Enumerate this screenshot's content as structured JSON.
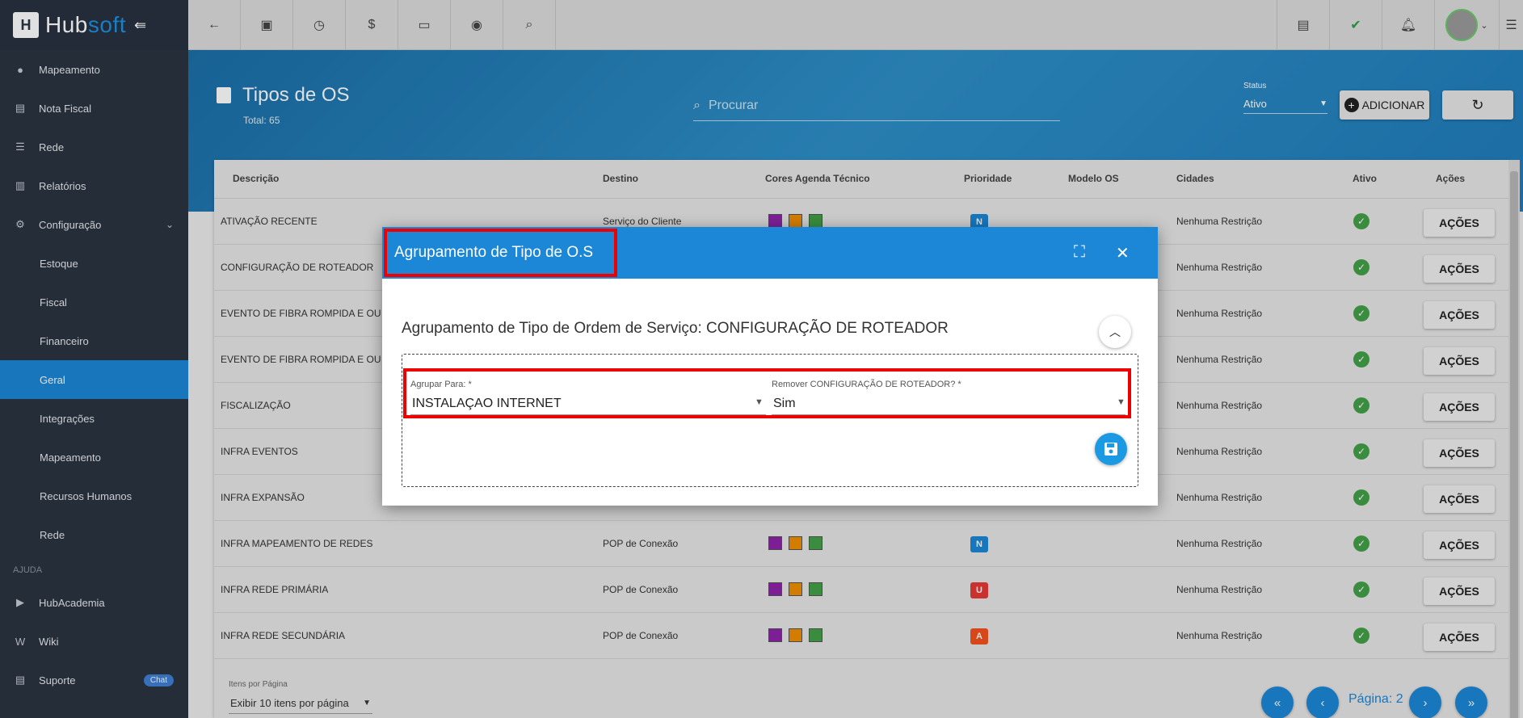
{
  "brand": {
    "name_part1": "Hub",
    "name_part2": "soft"
  },
  "sidebar": {
    "items": [
      {
        "label": "Mapeamento",
        "icon": "user-pin-icon"
      },
      {
        "label": "Nota Fiscal",
        "icon": "receipt-icon"
      },
      {
        "label": "Rede",
        "icon": "server-icon"
      },
      {
        "label": "Relatórios",
        "icon": "document-icon"
      },
      {
        "label": "Configuração",
        "icon": "gear-icon"
      }
    ],
    "subitems": [
      "Estoque",
      "Fiscal",
      "Financeiro",
      "Geral",
      "Integrações",
      "Mapeamento",
      "Recursos Humanos",
      "Rede"
    ],
    "active": "Geral",
    "section_label": "AJUDA",
    "help_items": [
      {
        "label": "HubAcademia",
        "icon": "youtube-icon"
      },
      {
        "label": "Wiki",
        "icon": "wiki-icon"
      },
      {
        "label": "Suporte",
        "icon": "chat-icon"
      }
    ],
    "chat_badge": "Chat"
  },
  "page": {
    "title": "Tipos de OS",
    "total": "Total: 65",
    "search_placeholder": "Procurar",
    "status_label": "Status",
    "status_value": "Ativo",
    "add_label": "ADICIONAR"
  },
  "table": {
    "headers": [
      "Descrição",
      "Destino",
      "Cores Agenda Técnico",
      "Prioridade",
      "Modelo OS",
      "Cidades",
      "Ativo",
      "Ações"
    ],
    "rows": [
      {
        "descricao": "ATIVAÇÃO RECENTE",
        "destino": "Serviço do Cliente",
        "prioridade": "N",
        "cidades": "Nenhuma Restrição"
      },
      {
        "descricao": "CONFIGURAÇÃO DE ROTEADOR",
        "destino": "",
        "prioridade": "",
        "cidades": "Nenhuma Restrição"
      },
      {
        "descricao": "EVENTO DE FIBRA ROMPIDA E OU A",
        "destino": "",
        "prioridade": "",
        "cidades": "Nenhuma Restrição"
      },
      {
        "descricao": "EVENTO DE FIBRA ROMPIDA E OU A",
        "destino": "",
        "prioridade": "",
        "cidades": "Nenhuma Restrição"
      },
      {
        "descricao": "FISCALIZAÇÃO",
        "destino": "",
        "prioridade": "",
        "cidades": "Nenhuma Restrição"
      },
      {
        "descricao": "INFRA EVENTOS",
        "destino": "",
        "prioridade": "",
        "cidades": "Nenhuma Restrição"
      },
      {
        "descricao": "INFRA EXPANSÃO",
        "destino": "",
        "prioridade": "",
        "cidades": "Nenhuma Restrição"
      },
      {
        "descricao": "INFRA MAPEAMENTO DE REDES",
        "destino": "POP de Conexão",
        "prioridade": "N",
        "cidades": "Nenhuma Restrição"
      },
      {
        "descricao": "INFRA REDE PRIMÁRIA",
        "destino": "POP de Conexão",
        "prioridade": "U",
        "cidades": "Nenhuma Restrição"
      },
      {
        "descricao": "INFRA REDE SECUNDÁRIA",
        "destino": "POP de Conexão",
        "prioridade": "A",
        "cidades": "Nenhuma Restrição"
      }
    ],
    "acoes_label": "AÇÕES",
    "swatch_colors": [
      "#8e24aa",
      "#ef8f00",
      "#43a047"
    ],
    "priority_colors": {
      "N": "#1b87d6",
      "U": "#e53935",
      "A": "#f4511e"
    }
  },
  "pager": {
    "label": "Itens por Página",
    "value": "Exibir 10 itens por página",
    "page_text": "Página: 2"
  },
  "modal": {
    "title": "Agrupamento de Tipo de O.S",
    "subtitle": "Agrupamento de Tipo de Ordem de Serviço: CONFIGURAÇÃO DE ROTEADOR",
    "field1_label": "Agrupar Para: *",
    "field1_value": "INSTALAÇAO INTERNET",
    "field2_label": "Remover CONFIGURAÇÃO DE ROTEADOR? *",
    "field2_value": "Sim"
  }
}
